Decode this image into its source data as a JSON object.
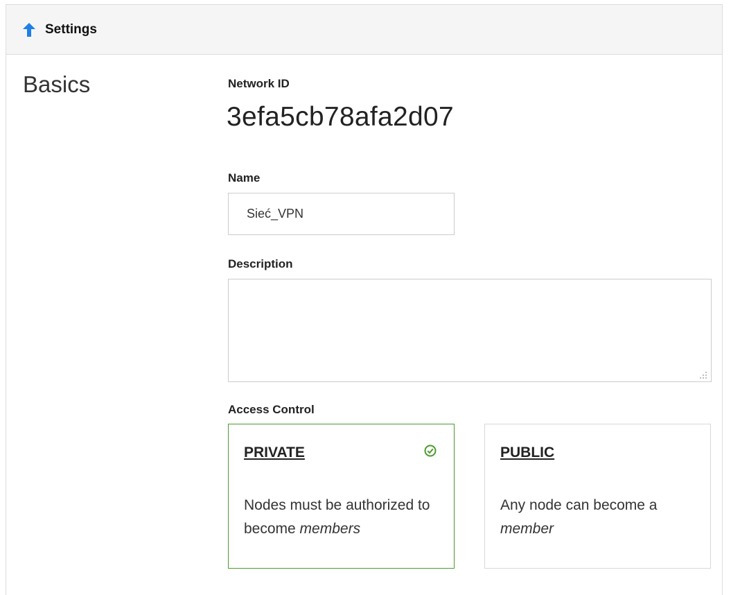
{
  "header": {
    "title": "Settings",
    "back_icon": "arrow-up-icon",
    "accent_color": "#1e7fe6"
  },
  "section": {
    "title": "Basics"
  },
  "network": {
    "id_label": "Network ID",
    "id_value": "3efa5cb78afa2d07"
  },
  "name": {
    "label": "Name",
    "value": "Sieć_VPN"
  },
  "description": {
    "label": "Description",
    "value": ""
  },
  "access_control": {
    "label": "Access Control",
    "selected": "private",
    "selected_color": "#4a9a2c",
    "options": [
      {
        "key": "private",
        "title": "PRIVATE",
        "text_before": "Nodes must be authorized to become ",
        "text_emphasis": "members",
        "text_after": "",
        "selected_icon": "check-circle-icon"
      },
      {
        "key": "public",
        "title": "PUBLIC",
        "text_before": "Any node can become a ",
        "text_emphasis": "member",
        "text_after": ""
      }
    ]
  }
}
